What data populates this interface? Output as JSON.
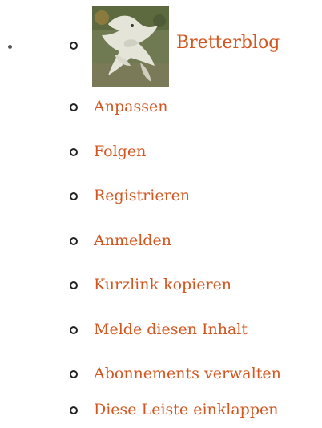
{
  "site": {
    "name": "Bretterblog",
    "thumbnail_icon": "bird-sculpture-thumbnail"
  },
  "menu": {
    "items": [
      {
        "label": "Anpassen"
      },
      {
        "label": "Folgen"
      },
      {
        "label": "Registrieren"
      },
      {
        "label": "Anmelden"
      },
      {
        "label": "Kurzlink kopieren"
      },
      {
        "label": "Melde diesen Inhalt"
      },
      {
        "label": "Abonnements verwalten"
      },
      {
        "label": "Diese Leiste einklappen"
      }
    ]
  },
  "colors": {
    "link": "#d2561f",
    "bullet": "#222222"
  }
}
